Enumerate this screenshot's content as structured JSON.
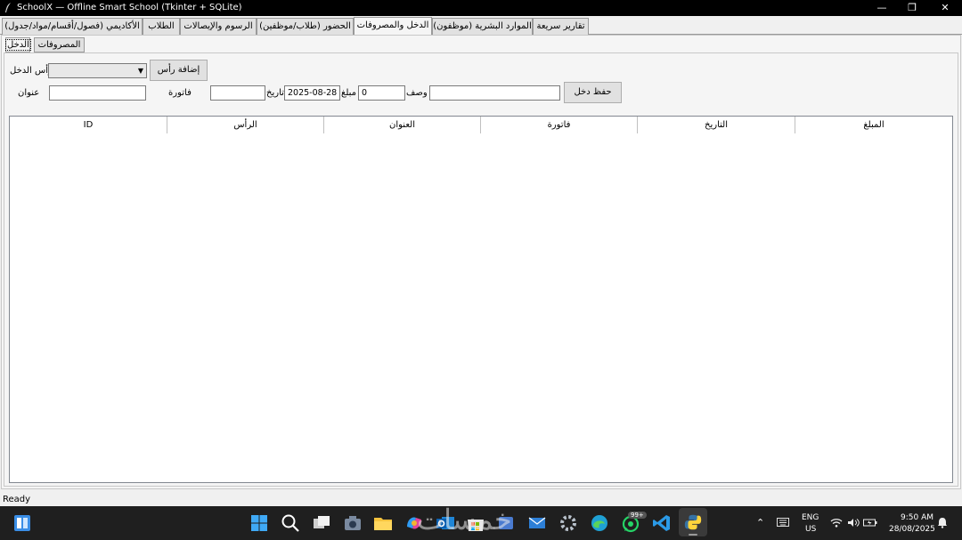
{
  "window": {
    "title": "SchoolX — Offline Smart School (Tkinter + SQLite)",
    "minimize": "—",
    "maximize": "❐",
    "close": "✕"
  },
  "tabs": [
    "تقارير سريعة",
    "الموارد البشرية (موظفون)",
    "الدخل والمصروفات",
    "الحضور (طلاب/موظفين)",
    "الرسوم والإيصالات",
    "الطلاب",
    "الأكاديمي (فصول/أقسام/مواد/جدول)"
  ],
  "active_tab": "الدخل والمصروفات",
  "subtabs": [
    "الدخل",
    "المصروفات"
  ],
  "active_subtab": "الدخل",
  "form": {
    "head_label": "رأس الدخل",
    "head_value": "",
    "add_head_button": "إضافة رأس",
    "title_label": "عنوان",
    "title_value": "",
    "invoice_label": "فاتورة",
    "invoice_value": "",
    "date_label": "تاريخ",
    "date_value": "2025-08-28",
    "amount_label": "مبلغ",
    "amount_value": "0",
    "desc_label": "وصف",
    "desc_value": "",
    "save_button": "حفظ دخل"
  },
  "table": {
    "columns": [
      "المبلغ",
      "التاريخ",
      "فاتورة",
      "العنوان",
      "الرأس",
      "ID"
    ],
    "rows": []
  },
  "status": "Ready",
  "tray": {
    "lang": "ENG",
    "region": "US",
    "time": "9:50 AM",
    "date": "28/08/2025",
    "badge": "99+"
  },
  "watermark": "خمسات",
  "colors": {
    "titlebar": "#000000",
    "taskbar": "#1f1f1f",
    "window_bg": "#f0f0f0",
    "tab_bg": "#e1e1e1"
  }
}
